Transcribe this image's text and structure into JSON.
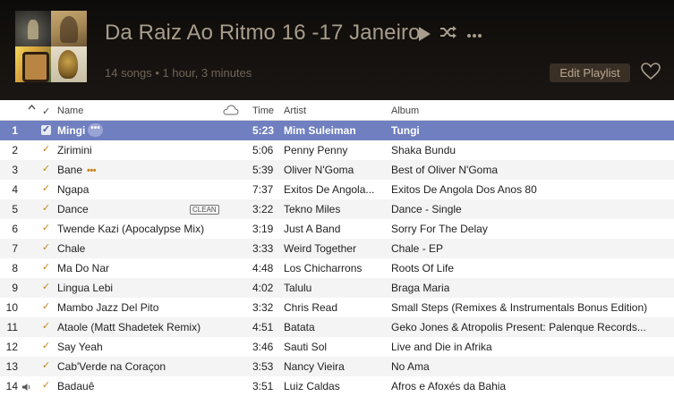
{
  "playlist": {
    "title": "Da Raiz Ao Ritmo 16 -17 Janeiro",
    "subtitle": "14 songs • 1 hour, 3 minutes",
    "edit_label": "Edit Playlist"
  },
  "icons": {
    "play": "play-icon",
    "shuffle": "shuffle-icon",
    "more": "more-icon",
    "heart": "heart-icon",
    "cloud": "cloud-icon",
    "speaker": "speaker-icon"
  },
  "columns": {
    "sort": "^",
    "check": "✓",
    "name": "Name",
    "time": "Time",
    "artist": "Artist",
    "album": "Album"
  },
  "rows": [
    {
      "num": "1",
      "name": "Mingi",
      "time": "5:23",
      "artist": "Mim Suleiman",
      "album": "Tungi",
      "selected": true,
      "more": "•••"
    },
    {
      "num": "2",
      "name": "Zirimini",
      "time": "5:06",
      "artist": "Penny Penny",
      "album": "Shaka Bundu"
    },
    {
      "num": "3",
      "name": "Bane",
      "time": "5:39",
      "artist": "Oliver N'Goma",
      "album": "Best of Oliver N'Goma",
      "inline_more": "•••"
    },
    {
      "num": "4",
      "name": "Ngapa",
      "time": "7:37",
      "artist": "Exitos De Angola...",
      "album": "Exitos De Angola Dos Anos 80"
    },
    {
      "num": "5",
      "name": "Dance",
      "time": "3:22",
      "artist": "Tekno Miles",
      "album": "Dance - Single",
      "badge": "CLEAN"
    },
    {
      "num": "6",
      "name": "Twende Kazi (Apocalypse Mix)",
      "time": "3:19",
      "artist": "Just A Band",
      "album": "Sorry For The Delay"
    },
    {
      "num": "7",
      "name": "Chale",
      "time": "3:33",
      "artist": "Weird Together",
      "album": "Chale - EP"
    },
    {
      "num": "8",
      "name": "Ma Do Nar",
      "time": "4:48",
      "artist": "Los Chicharrons",
      "album": "Roots Of Life"
    },
    {
      "num": "9",
      "name": "Lingua Lebi",
      "time": "4:02",
      "artist": "Talulu",
      "album": "Braga Maria"
    },
    {
      "num": "10",
      "name": "Mambo Jazz Del Pito",
      "time": "3:32",
      "artist": "Chris Read",
      "album": "Small Steps (Remixes & Instrumentals Bonus Edition)"
    },
    {
      "num": "11",
      "name": "Ataole (Matt Shadetek Remix)",
      "time": "4:51",
      "artist": "Batata",
      "album": "Geko Jones & Atropolis Present: Palenque Records..."
    },
    {
      "num": "12",
      "name": "Say Yeah",
      "time": "3:46",
      "artist": "Sauti Sol",
      "album": "Live and Die in Afrika"
    },
    {
      "num": "13",
      "name": "Cab'Verde na Coraçon",
      "time": "3:53",
      "artist": "Nancy Vieira",
      "album": "No Ama"
    },
    {
      "num": "14",
      "name": "Badauê",
      "time": "3:51",
      "artist": "Luiz Caldas",
      "album": "Afros e Afoxés da Bahia",
      "playing": true
    }
  ]
}
